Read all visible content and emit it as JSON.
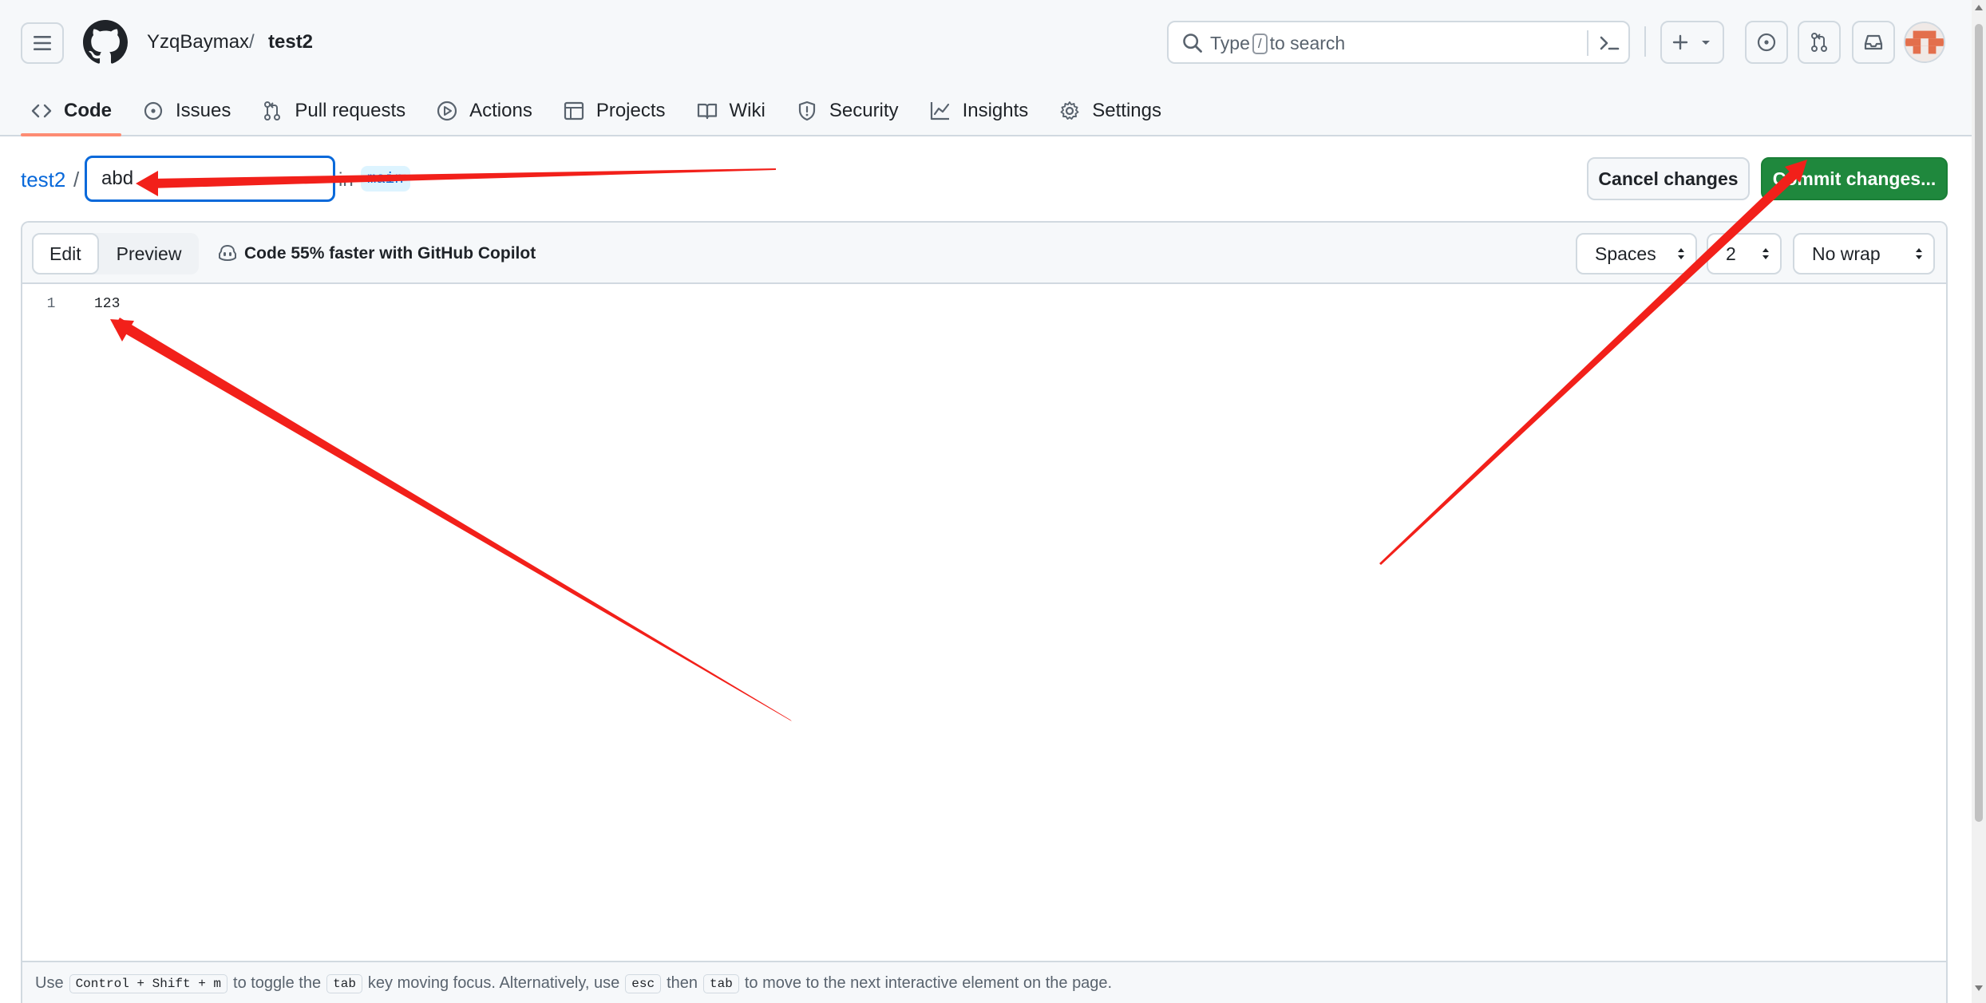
{
  "header": {
    "owner": "YzqBaymax",
    "separator": "/",
    "repo": "test2",
    "search": {
      "prefix": "Type",
      "key": "/",
      "suffix": "to search"
    }
  },
  "tabs": [
    {
      "label": "Code",
      "icon": "code-icon",
      "active": true
    },
    {
      "label": "Issues",
      "icon": "issue-icon"
    },
    {
      "label": "Pull requests",
      "icon": "pull-request-icon"
    },
    {
      "label": "Actions",
      "icon": "play-icon"
    },
    {
      "label": "Projects",
      "icon": "table-icon"
    },
    {
      "label": "Wiki",
      "icon": "book-icon"
    },
    {
      "label": "Security",
      "icon": "shield-icon"
    },
    {
      "label": "Insights",
      "icon": "graph-icon"
    },
    {
      "label": "Settings",
      "icon": "gear-icon"
    }
  ],
  "path": {
    "repo_link": "test2",
    "separator": "/",
    "filename_value": "abd",
    "in_label": "in",
    "branch": "main"
  },
  "actions": {
    "cancel_label": "Cancel changes",
    "commit_label": "Commit changes..."
  },
  "editor": {
    "mode_edit": "Edit",
    "mode_preview": "Preview",
    "copilot_text": "Code 55% faster with GitHub Copilot",
    "indent_mode": "Spaces",
    "indent_size": "2",
    "wrap_mode": "No wrap",
    "lines": [
      {
        "number": "1",
        "text": "123"
      }
    ]
  },
  "footer": {
    "t1": "Use",
    "k1": "Control + Shift + m",
    "t2": "to toggle the",
    "k2": "tab",
    "t3": "key moving focus. Alternatively, use",
    "k3": "esc",
    "t4": "then",
    "k4": "tab",
    "t5": "to move to the next interactive element on the page."
  },
  "colors": {
    "accent": "#0969da",
    "commit_green": "#1f883d",
    "active_tab_underline": "#fd8c73",
    "annotation_red": "#f2201a"
  }
}
